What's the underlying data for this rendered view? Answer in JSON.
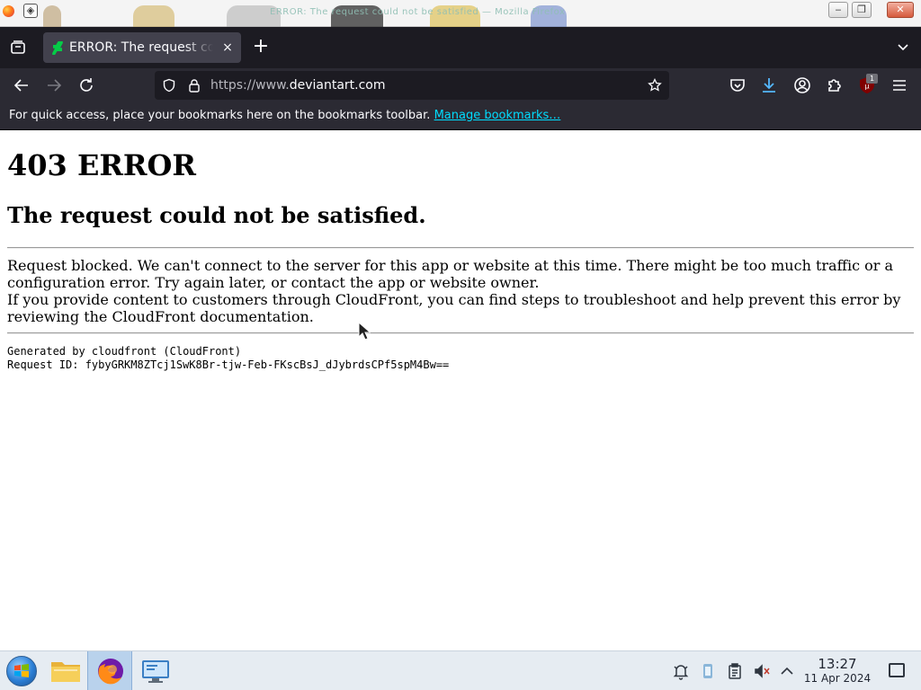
{
  "window": {
    "ghost_title": "ERROR: The request could not be satisfied — Mozilla Firefox"
  },
  "tab": {
    "title": "ERROR: The request could not be satisfied",
    "close": "×"
  },
  "newtab": "+",
  "urlbar": {
    "prefix": "https://www.",
    "host": "deviantart.com"
  },
  "toolbar": {
    "extension_badge": "1"
  },
  "bookmarks": {
    "message": "For quick access, place your bookmarks here on the bookmarks toolbar. ",
    "manage_link": "Manage bookmarks…"
  },
  "page": {
    "heading": "403 ERROR",
    "subheading": "The request could not be satisfied.",
    "paragraph1": "Request blocked. We can't connect to the server for this app or website at this time. There might be too much traffic or a configuration error. Try again later, or contact the app or website owner.",
    "paragraph2": "If you provide content to customers through CloudFront, you can find steps to troubleshoot and help prevent this error by reviewing the CloudFront documentation.",
    "generated_by": "Generated by cloudfront (CloudFront)",
    "request_id": "Request ID: fybyGRKM8ZTcj1SwK8Br-tjw-Feb-FKscBsJ_dJybrdsCPf5spM4Bw=="
  },
  "taskbar": {
    "time": "13:27",
    "date": "11 Apr 2024"
  },
  "colors": {
    "tabstrip_bg": "#1c1b22",
    "toolbar_bg": "#2b2a33",
    "link": "#00ddff",
    "download_icon": "#54b8ff",
    "ublock": "#800000"
  }
}
